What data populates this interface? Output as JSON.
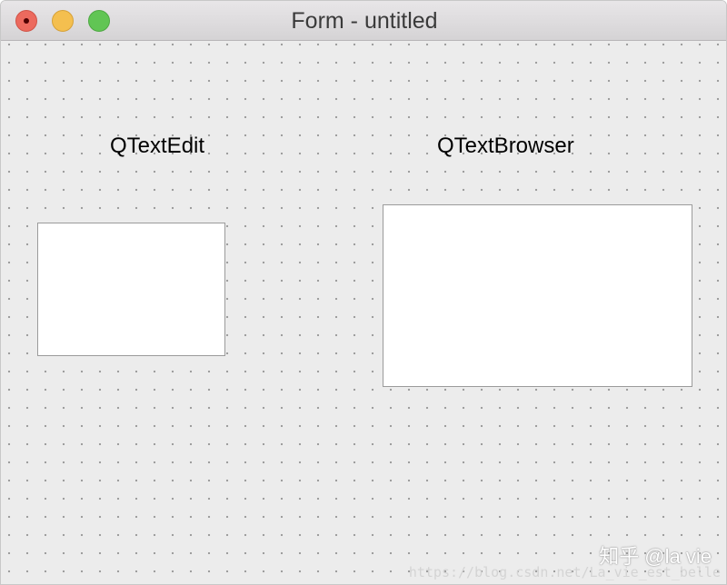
{
  "window": {
    "title": "Form - untitled"
  },
  "form": {
    "textedit_label": "QTextEdit",
    "textbrowser_label": "QTextBrowser"
  },
  "watermark": {
    "zhihu": "知乎 @la vie",
    "url": "https://blog.csdn.net/La_vie_est_belle"
  },
  "colors": {
    "close": "#ec6a5e",
    "minimize": "#f4bf4f",
    "zoom": "#61c554",
    "canvas": "#ececec"
  }
}
